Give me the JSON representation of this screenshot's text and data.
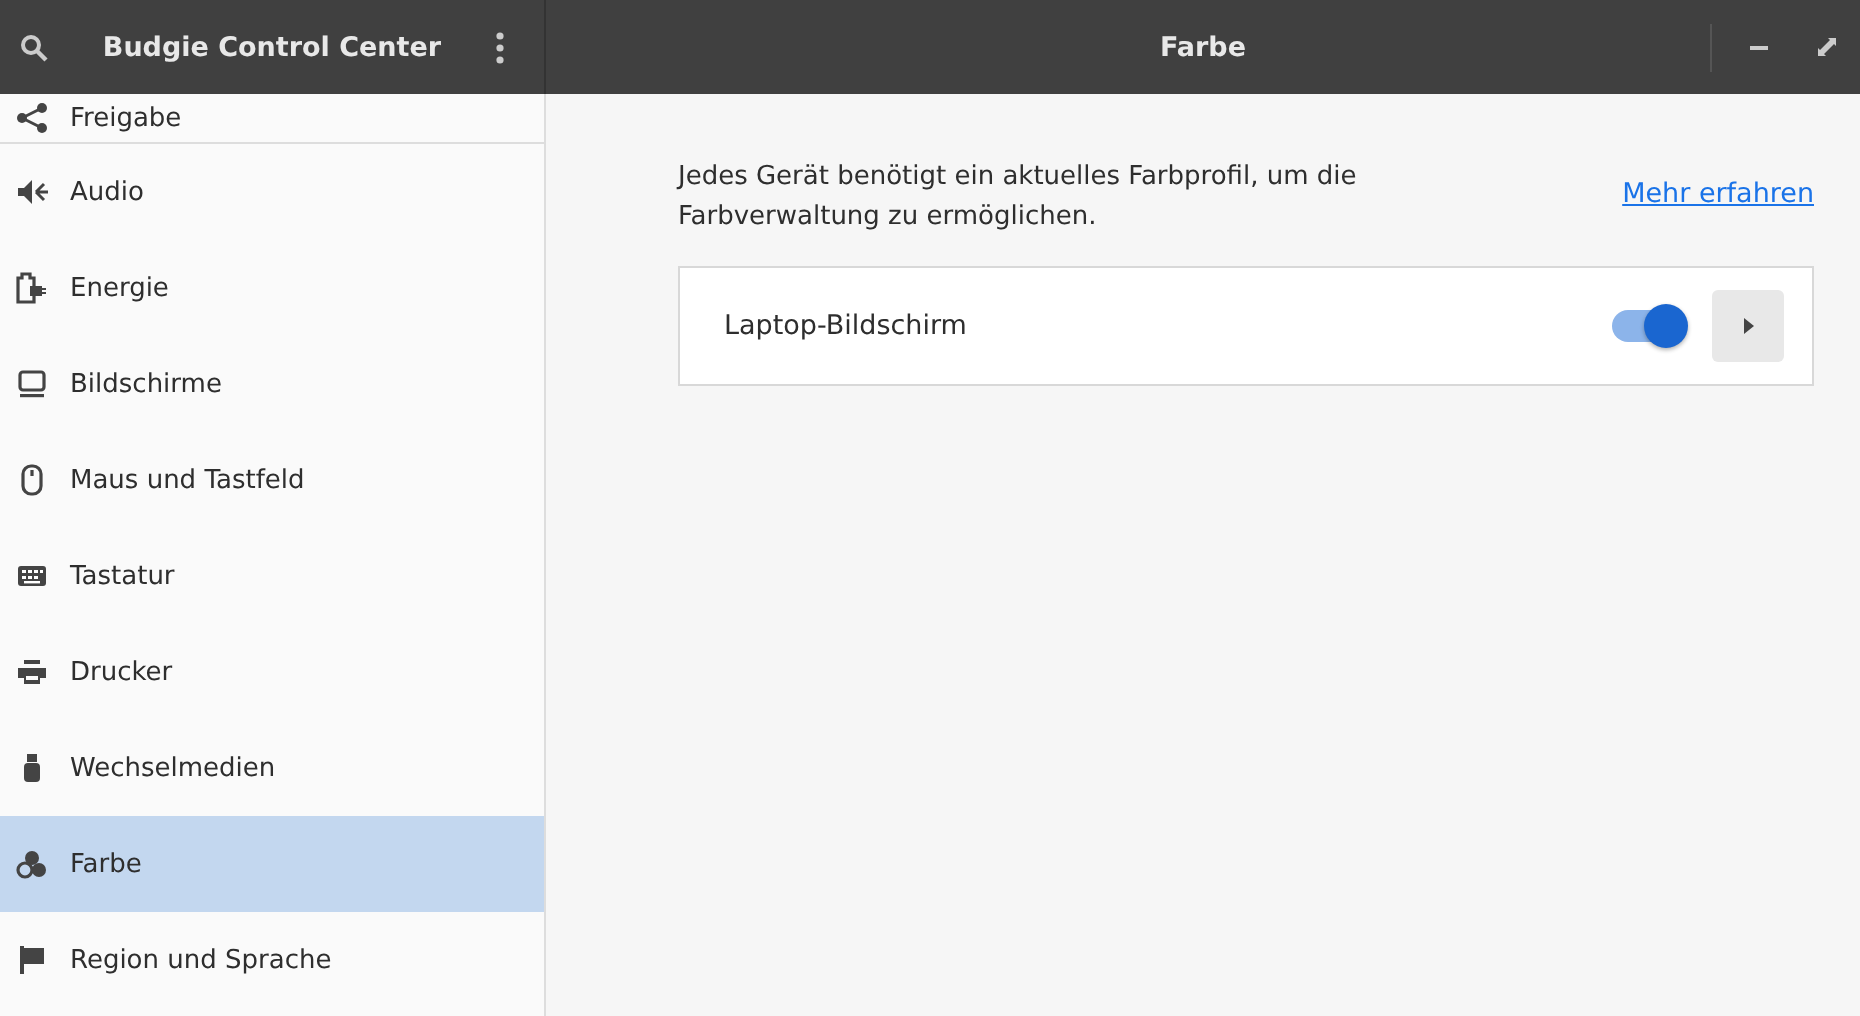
{
  "sidebar": {
    "title": "Budgie Control Center",
    "items": [
      {
        "label": "Freigabe",
        "kind": "share",
        "selected": false
      },
      {
        "label": "Audio",
        "kind": "audio",
        "selected": false
      },
      {
        "label": "Energie",
        "kind": "power",
        "selected": false
      },
      {
        "label": "Bildschirme",
        "kind": "display",
        "selected": false
      },
      {
        "label": "Maus und Tastfeld",
        "kind": "mouse",
        "selected": false
      },
      {
        "label": "Tastatur",
        "kind": "keyboard",
        "selected": false
      },
      {
        "label": "Drucker",
        "kind": "printer",
        "selected": false
      },
      {
        "label": "Wechselmedien",
        "kind": "usb",
        "selected": false
      },
      {
        "label": "Farbe",
        "kind": "color",
        "selected": true
      },
      {
        "label": "Region und Sprache",
        "kind": "flag",
        "selected": false
      }
    ]
  },
  "window": {
    "title": "Farbe"
  },
  "info": {
    "text": "Jedes Gerät benötigt ein aktuelles Farbprofil, um die Farbverwaltung zu ermöglichen.",
    "link": "Mehr erfahren"
  },
  "devices": [
    {
      "name": "Laptop-Bildschirm",
      "on": true
    }
  ]
}
